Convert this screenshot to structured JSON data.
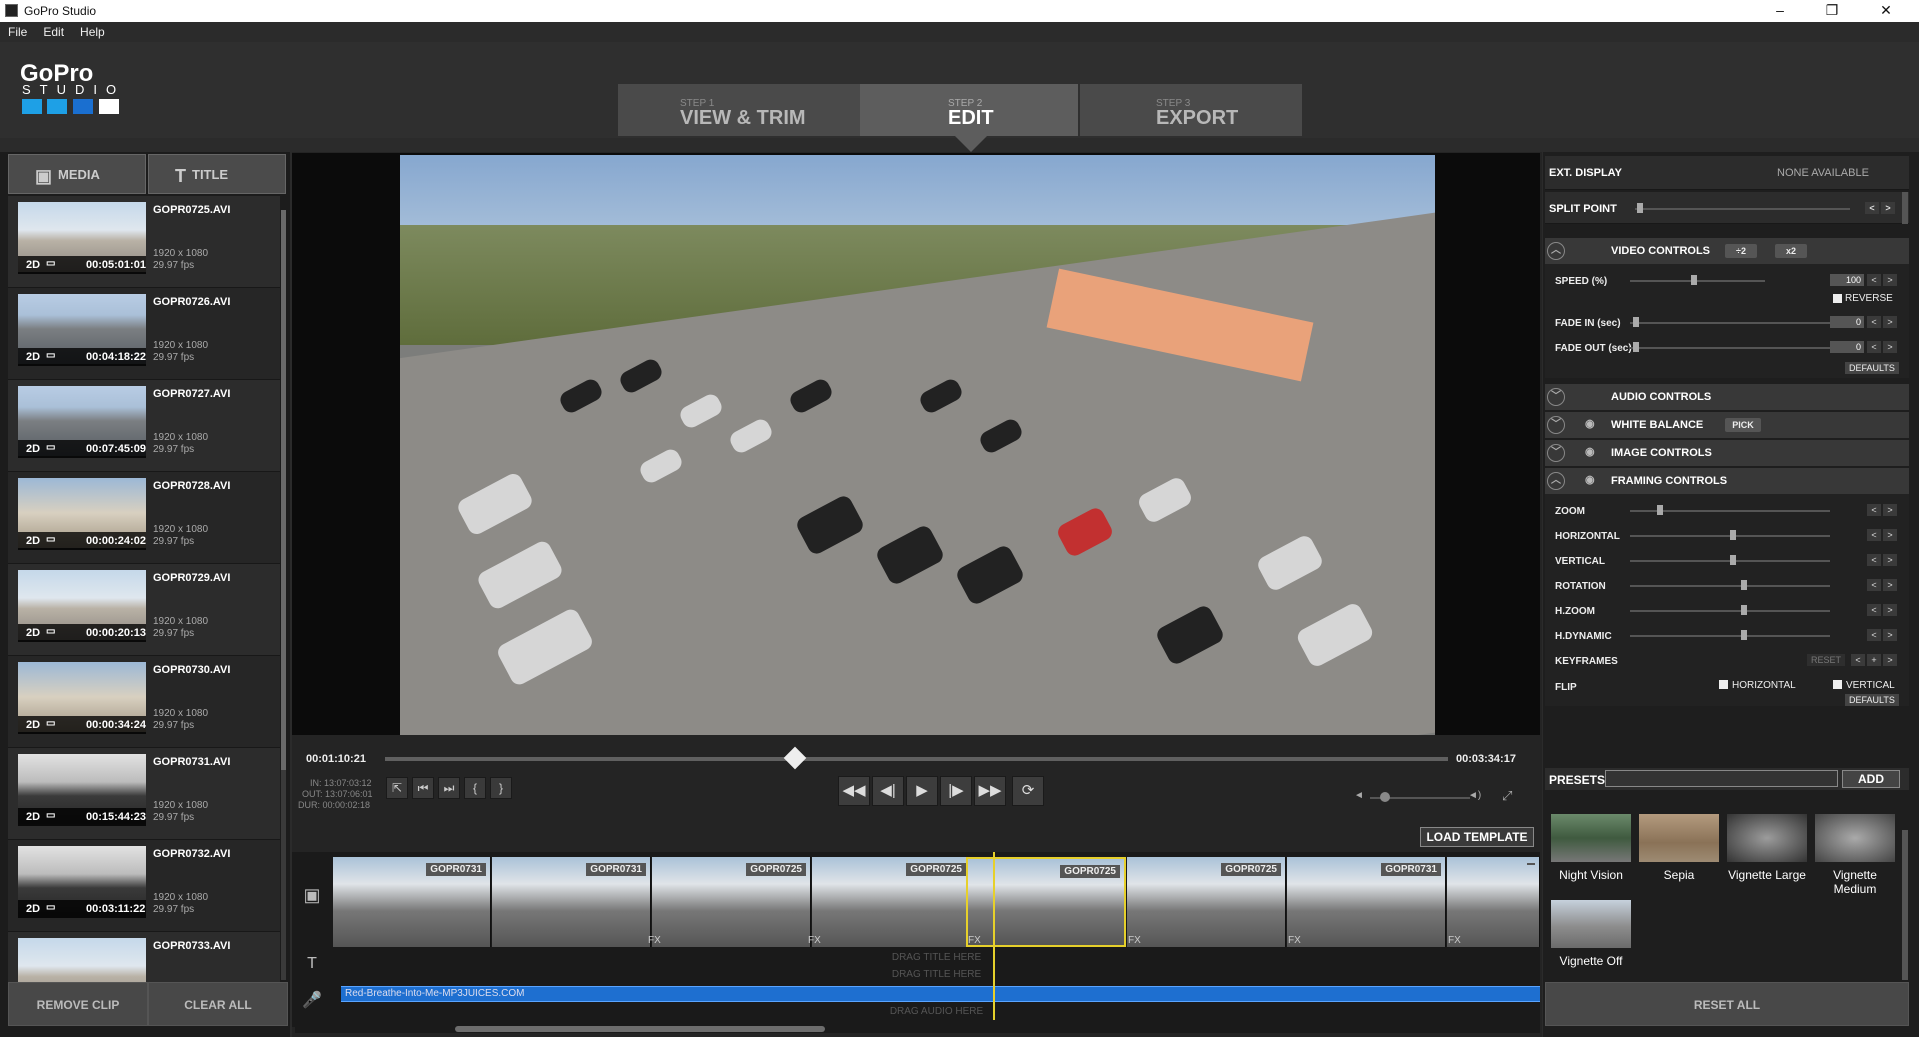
{
  "window": {
    "title": "GoPro Studio",
    "minimize": "–",
    "maximize": "❐",
    "close": "✕"
  },
  "menu": [
    "File",
    "Edit",
    "Help"
  ],
  "logo": {
    "name": "GoPro",
    "sub": "STUDIO"
  },
  "steps": [
    {
      "num": "STEP 1",
      "label": "VIEW & TRIM"
    },
    {
      "num": "STEP 2",
      "label": "EDIT"
    },
    {
      "num": "STEP 3",
      "label": "EXPORT"
    }
  ],
  "left_tabs": {
    "media": "MEDIA",
    "title": "TITLE"
  },
  "media": [
    {
      "name": "GOPR0725.AVI",
      "mode": "2D",
      "duration": "00:05:01:01",
      "res": "1920 x 1080",
      "fps": "29.97 fps"
    },
    {
      "name": "GOPR0726.AVI",
      "mode": "2D",
      "duration": "00:04:18:22",
      "res": "1920 x 1080",
      "fps": "29.97 fps"
    },
    {
      "name": "GOPR0727.AVI",
      "mode": "2D",
      "duration": "00:07:45:09",
      "res": "1920 x 1080",
      "fps": "29.97 fps"
    },
    {
      "name": "GOPR0728.AVI",
      "mode": "2D",
      "duration": "00:00:24:02",
      "res": "1920 x 1080",
      "fps": "29.97 fps"
    },
    {
      "name": "GOPR0729.AVI",
      "mode": "2D",
      "duration": "00:00:20:13",
      "res": "1920 x 1080",
      "fps": "29.97 fps"
    },
    {
      "name": "GOPR0730.AVI",
      "mode": "2D",
      "duration": "00:00:34:24",
      "res": "1920 x 1080",
      "fps": "29.97 fps"
    },
    {
      "name": "GOPR0731.AVI",
      "mode": "2D",
      "duration": "00:15:44:23",
      "res": "1920 x 1080",
      "fps": "29.97 fps"
    },
    {
      "name": "GOPR0732.AVI",
      "mode": "2D",
      "duration": "00:03:11:22",
      "res": "1920 x 1080",
      "fps": "29.97 fps"
    },
    {
      "name": "GOPR0733.AVI"
    }
  ],
  "left_buttons": {
    "remove": "REMOVE CLIP",
    "clear": "CLEAR ALL"
  },
  "playback": {
    "current": "00:01:10:21",
    "total": "00:03:34:17",
    "in": "IN: 13:07:03:12",
    "out": "OUT: 13:07:06:01",
    "dur": "DUR: 00:00:02:18",
    "progress_fraction": 0.386
  },
  "load_template": "LOAD TEMPLATE",
  "timeline": {
    "clips": [
      "GOPR0731",
      "GOPR0731",
      "GOPR0725",
      "GOPR0725",
      "GOPR0725",
      "GOPR0725",
      "GOPR0731",
      ""
    ],
    "fx": "FX",
    "drag_title_1": "DRAG TITLE HERE",
    "drag_title_2": "DRAG TITLE HERE",
    "audio": "Red-Breathe-Into-Me-MP3JUICES.COM",
    "drag_audio": "DRAG AUDIO HERE"
  },
  "right": {
    "ext_display": "EXT. DISPLAY",
    "ext_value": "NONE AVAILABLE",
    "split_point": "SPLIT POINT",
    "video_controls": "VIDEO CONTROLS",
    "half": "÷2",
    "double": "x2",
    "speed": "SPEED (%)",
    "speed_value": "100",
    "reverse": "REVERSE",
    "fade_in": "FADE IN (sec)",
    "fade_in_value": "0",
    "fade_out": "FADE OUT (sec)",
    "fade_out_value": "0",
    "defaults": "DEFAULTS",
    "audio_controls": "AUDIO CONTROLS",
    "white_balance": "WHITE BALANCE",
    "pick": "PICK",
    "image_controls": "IMAGE CONTROLS",
    "framing_controls": "FRAMING CONTROLS",
    "zoom": "ZOOM",
    "horizontal": "HORIZONTAL",
    "vertical": "VERTICAL",
    "rotation": "ROTATION",
    "hzoom": "H.ZOOM",
    "hdynamic": "H.DYNAMIC",
    "keyframes": "KEYFRAMES",
    "reset": "RESET",
    "flip": "FLIP",
    "flip_h": "HORIZONTAL",
    "flip_v": "VERTICAL",
    "defaults2": "DEFAULTS",
    "presets": "PRESETS",
    "add": "ADD",
    "preset_items": [
      "Night Vision",
      "Sepia",
      "Vignette Large",
      "Vignette Medium",
      "Vignette Off"
    ],
    "reset_all": "RESET ALL"
  },
  "colors": {
    "accent_yellow": "#e6d02b",
    "audio_blue": "#1e6fd0",
    "logo_blue": "#1ea0e6"
  }
}
